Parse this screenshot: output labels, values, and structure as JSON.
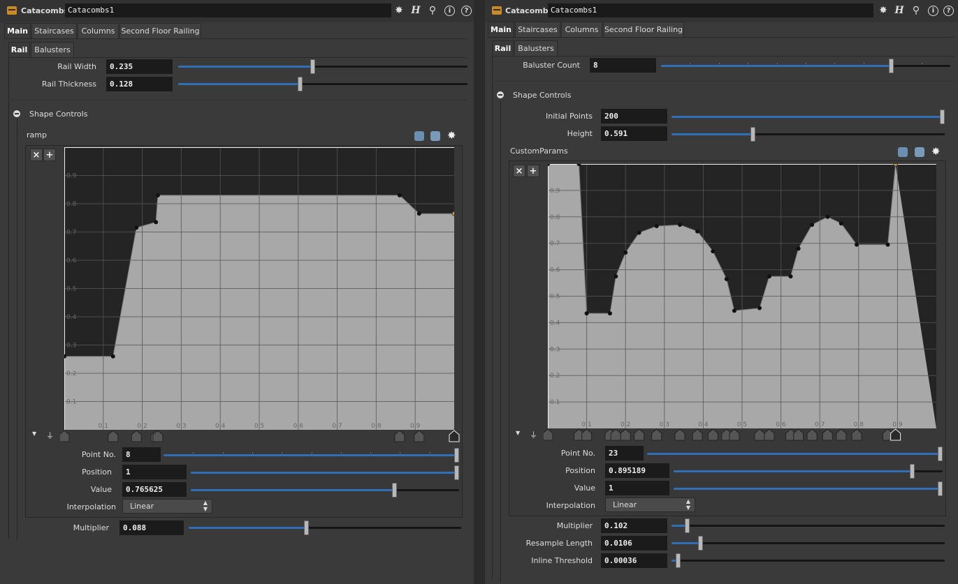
{
  "left": {
    "header": {
      "type_label": "Catacombs",
      "node_name": "Catacombs1"
    },
    "tabs": [
      "Main",
      "Staircases",
      "Columns",
      "Second Floor Railing"
    ],
    "subtabs": [
      "Rail",
      "Balusters"
    ],
    "params_top": [
      {
        "label": "Rail Width",
        "value": "0.235",
        "fraction": 0.465
      },
      {
        "label": "Rail Thickness",
        "value": "0.128",
        "fraction": 0.42
      }
    ],
    "section_title": "Shape Controls",
    "ramp": {
      "label": "ramp",
      "x_ticks": [
        "0.1",
        "0.2",
        "0.3",
        "0.4",
        "0.5",
        "0.6",
        "0.7",
        "0.8",
        "0.9"
      ],
      "y_ticks": [
        "0.1",
        "0.2",
        "0.3",
        "0.4",
        "0.5",
        "0.6",
        "0.7",
        "0.8",
        "0.9"
      ],
      "points": [
        [
          0,
          0.26
        ],
        [
          0.125,
          0.26
        ],
        [
          0.185,
          0.715
        ],
        [
          0.235,
          0.735
        ],
        [
          0.24,
          0.83
        ],
        [
          0.86,
          0.83
        ],
        [
          0.91,
          0.765
        ],
        [
          1,
          0.765
        ]
      ],
      "selected_index": 7,
      "point_no": {
        "label": "Point No.",
        "value": "8",
        "fraction": 1.0
      },
      "position": {
        "label": "Position",
        "value": "1",
        "fraction": 1.0
      },
      "value": {
        "label": "Value",
        "value": "0.765625",
        "fraction": 0.765
      },
      "interpolation": {
        "label": "Interpolation",
        "value": "Linear"
      }
    },
    "multiplier": {
      "label": "Multiplier",
      "value": "0.088",
      "fraction": 0.43
    }
  },
  "right": {
    "header": {
      "type_label": "Catacombs",
      "node_name": "Catacombs1"
    },
    "tabs": [
      "Main",
      "Staircases",
      "Columns",
      "Second Floor Railing"
    ],
    "subtabs": [
      "Rail",
      "Balusters"
    ],
    "params_top": [
      {
        "label": "Baluster Count",
        "value": "8",
        "fraction": 0.8
      }
    ],
    "section_title": "Shape Controls",
    "section_params": [
      {
        "label": "Initial Points",
        "value": "200",
        "fraction": 1.0
      },
      {
        "label": "Height",
        "value": "0.591",
        "fraction": 0.295
      }
    ],
    "ramp": {
      "label": "CustomParams",
      "x_ticks": [
        "0.1",
        "0.2",
        "0.3",
        "0.4",
        "0.5",
        "0.6",
        "0.7",
        "0.8",
        "0.9"
      ],
      "y_ticks": [
        "0.1",
        "0.2",
        "0.3",
        "0.4",
        "0.5",
        "0.6",
        "0.7",
        "0.8",
        "0.9"
      ],
      "points": [
        [
          0,
          1
        ],
        [
          0.08,
          1
        ],
        [
          0.1,
          0.435
        ],
        [
          0.16,
          0.435
        ],
        [
          0.175,
          0.575
        ],
        [
          0.2,
          0.665
        ],
        [
          0.235,
          0.74
        ],
        [
          0.28,
          0.765
        ],
        [
          0.34,
          0.77
        ],
        [
          0.385,
          0.745
        ],
        [
          0.425,
          0.67
        ],
        [
          0.46,
          0.565
        ],
        [
          0.48,
          0.445
        ],
        [
          0.545,
          0.455
        ],
        [
          0.57,
          0.575
        ],
        [
          0.625,
          0.575
        ],
        [
          0.645,
          0.68
        ],
        [
          0.68,
          0.77
        ],
        [
          0.72,
          0.8
        ],
        [
          0.755,
          0.775
        ],
        [
          0.795,
          0.695
        ],
        [
          0.875,
          0.695
        ],
        [
          0.895,
          1
        ]
      ],
      "selected_index": 22,
      "point_no": {
        "label": "Point No.",
        "value": "23",
        "fraction": 1.0
      },
      "position": {
        "label": "Position",
        "value": "0.895189",
        "fraction": 0.895
      },
      "value": {
        "label": "Value",
        "value": "1",
        "fraction": 1.0
      },
      "interpolation": {
        "label": "Interpolation",
        "value": "Linear"
      }
    },
    "bottom_params": [
      {
        "label": "Multiplier",
        "value": "0.102",
        "fraction": 0.05
      },
      {
        "label": "Resample Length",
        "value": "0.0106",
        "fraction": 0.1
      },
      {
        "label": "Inline Threshold",
        "value": "0.00036",
        "fraction": 0.015
      }
    ]
  }
}
